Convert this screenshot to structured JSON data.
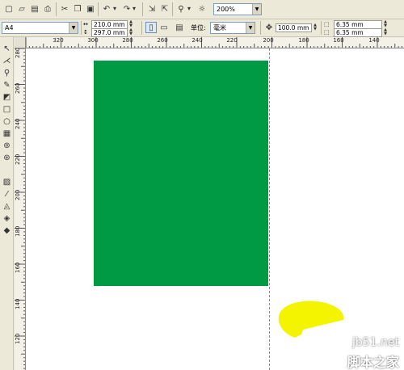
{
  "standard_toolbar": {
    "zoom_value": "200%",
    "icons": [
      "new-file-icon",
      "open-icon",
      "save-icon",
      "print-icon",
      "cut-icon",
      "copy-icon",
      "paste-icon",
      "undo-icon",
      "redo-icon",
      "import-icon",
      "export-icon",
      "application-launcher-icon",
      "welcome-screen-icon"
    ]
  },
  "property_bar": {
    "paper_size": "A4",
    "width": "210.0 mm",
    "height": "297.0 mm",
    "units_label": "单位:",
    "units_value": "毫米",
    "nudge": "100.0 mm",
    "duplicate_x": "6.35 mm",
    "duplicate_y": "6.35 mm"
  },
  "ruler": {
    "horizontal": [
      "320",
      "300",
      "280",
      "260",
      "240",
      "220",
      "200",
      "180",
      "160",
      "140"
    ],
    "vertical": [
      "280",
      "260",
      "240",
      "220",
      "200",
      "180",
      "160",
      "140",
      "120"
    ]
  },
  "canvas": {
    "green_color": "#009a44",
    "yellow_color": "#f4f400"
  },
  "watermark": {
    "url": "jb51.net",
    "name": "脚本之家"
  }
}
